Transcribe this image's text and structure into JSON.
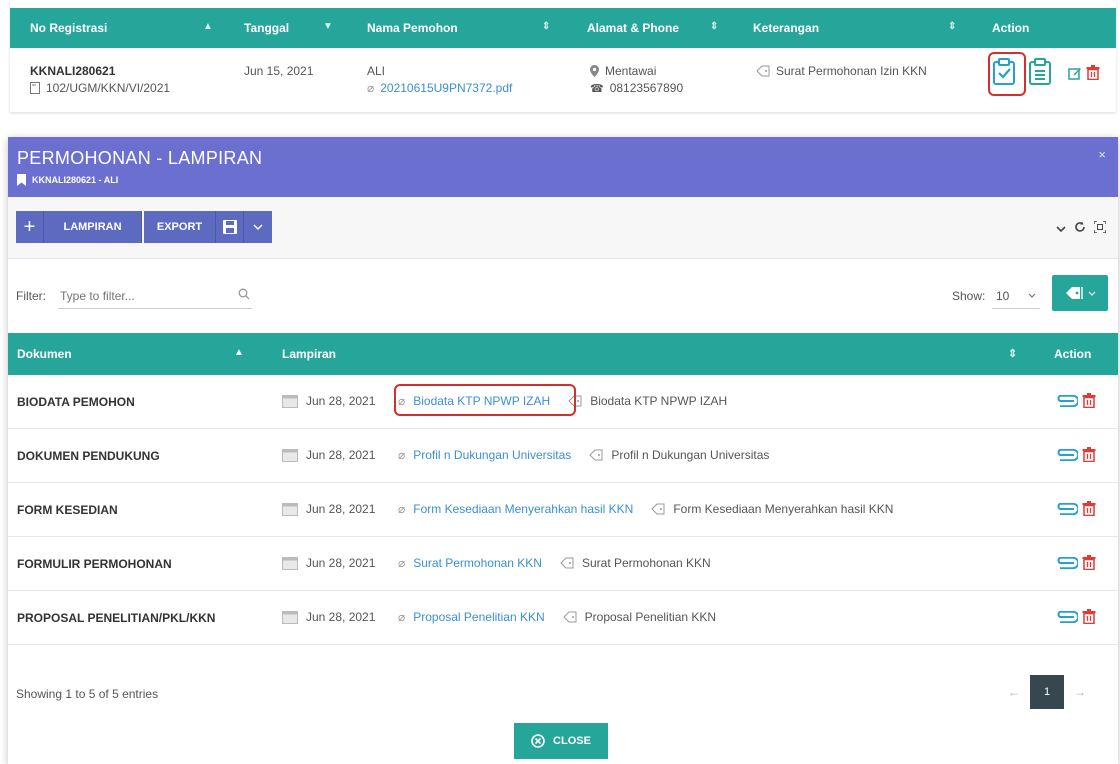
{
  "top_table": {
    "headers": [
      "No Registrasi",
      "Tanggal",
      "Nama Pemohon",
      "Alamat & Phone",
      "Keterangan",
      "Action"
    ],
    "row": {
      "reg_no": "KKNALI280621",
      "reg_ref": "102/UGM/KKN/VI/2021",
      "date": "Jun 15, 2021",
      "name": "ALI",
      "file": "20210615U9PN7372.pdf",
      "address": "Mentawai",
      "phone": "08123567890",
      "note": "Surat Permohonan Izin KKN"
    }
  },
  "modal": {
    "title": "PERMOHONAN - LAMPIRAN",
    "subtitle": "KKNALI280621 - ALI",
    "close_x": "×",
    "toolbar": {
      "add_label": "LAMPIRAN",
      "export_label": "EXPORT"
    },
    "filter": {
      "label": "Filter:",
      "placeholder": "Type to filter..."
    },
    "show": {
      "label": "Show:",
      "value": "10"
    },
    "table": {
      "headers": [
        "Dokumen",
        "Lampiran",
        "Action"
      ],
      "rows": [
        {
          "doc": "BIODATA PEMOHON",
          "date": "Jun 28, 2021",
          "link": "Biodata KTP NPWP IZAH",
          "tag": "Biodata KTP NPWP IZAH"
        },
        {
          "doc": "DOKUMEN PENDUKUNG",
          "date": "Jun 28, 2021",
          "link": "Profil n Dukungan Universitas",
          "tag": "Profil n Dukungan Universitas"
        },
        {
          "doc": "FORM KESEDIAN",
          "date": "Jun 28, 2021",
          "link": "Form Kesediaan Menyerahkan hasil KKN",
          "tag": "Form Kesediaan Menyerahkan hasil KKN"
        },
        {
          "doc": "FORMULIR PERMOHONAN",
          "date": "Jun 28, 2021",
          "link": "Surat Permohonan KKN",
          "tag": "Surat Permohonan KKN"
        },
        {
          "doc": "PROPOSAL PENELITIAN/PKL/KKN",
          "date": "Jun 28, 2021",
          "link": "Proposal Penelitian KKN",
          "tag": "Proposal Penelitian KKN"
        }
      ]
    },
    "footer": {
      "showing": "Showing 1 to 5 of 5 entries",
      "prev": "←",
      "page": "1",
      "next": "→",
      "close_label": "CLOSE"
    }
  },
  "colors": {
    "teal": "#26a69a",
    "indigo_header": "#6b6fd0",
    "button_indigo": "#5c6bc0",
    "link_blue": "#3a8fd6",
    "delete_red": "#e53935",
    "highlight_red": "#d32f2f"
  }
}
